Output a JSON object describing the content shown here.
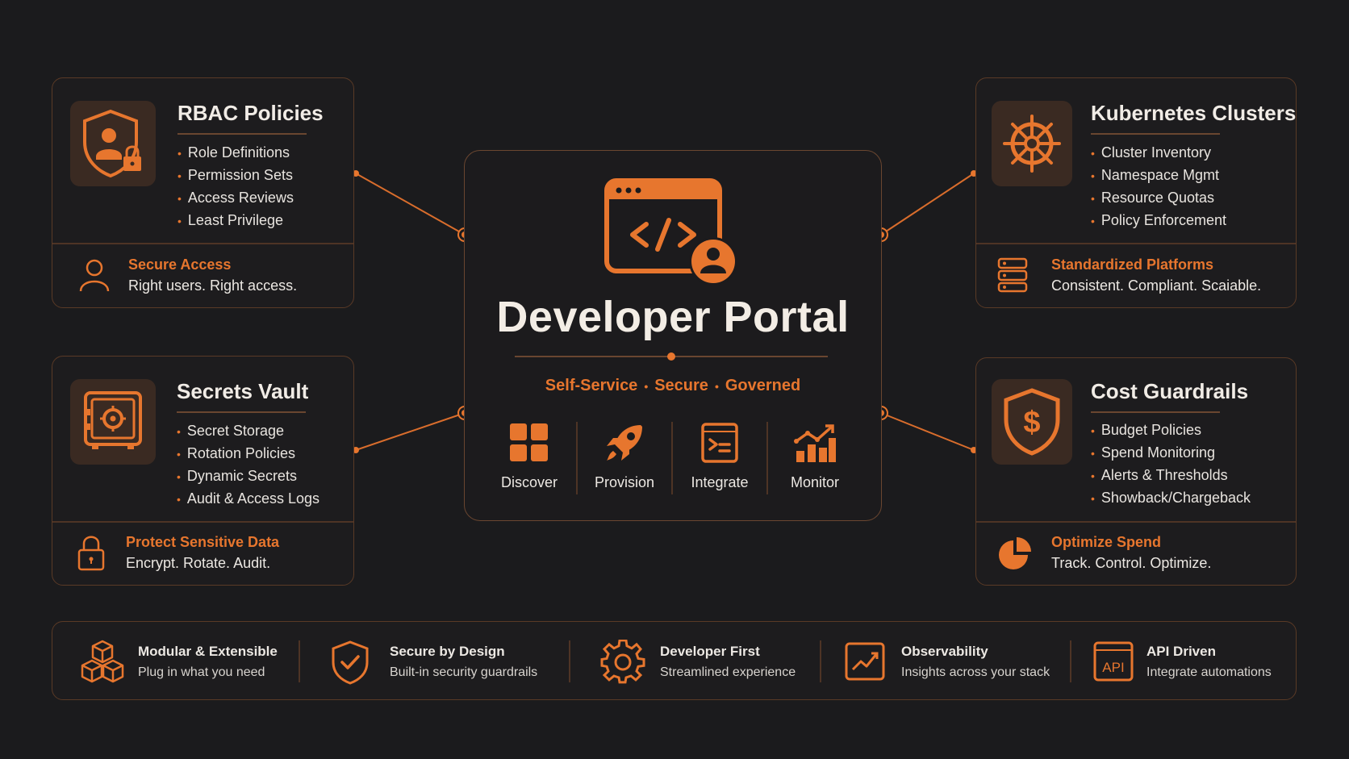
{
  "cards": {
    "rbac": {
      "title": "RBAC Policies",
      "items": [
        "Role Definitions",
        "Permission Sets",
        "Access Reviews",
        "Least Privilege"
      ],
      "footer_title": "Secure Access",
      "footer_sub": "Right users. Right access."
    },
    "k8s": {
      "title": "Kubernetes Clusters",
      "items": [
        "Cluster Inventory",
        "Namespace Mgmt",
        "Resource Quotas",
        "Policy Enforcement"
      ],
      "footer_title": "Standardized Platforms",
      "footer_sub": "Consistent. Compliant. Scaiable."
    },
    "vault": {
      "title": "Secrets Vault",
      "items": [
        "Secret Storage",
        "Rotation Policies",
        "Dynamic Secrets",
        "Audit & Access Logs"
      ],
      "footer_title": "Protect Sensitive Data",
      "footer_sub": "Encrypt. Rotate. Audit."
    },
    "cost": {
      "title": "Cost Guardrails",
      "items": [
        "Budget Policies",
        "Spend Monitoring",
        "Alerts & Thresholds",
        "Showback/Chargeback"
      ],
      "footer_title": "Optimize Spend",
      "footer_sub": "Track. Control. Optimize."
    }
  },
  "center": {
    "title": "Developer Portal",
    "tagline": [
      "Self-Service",
      "Secure",
      "Governed"
    ],
    "actions": [
      "Discover",
      "Provision",
      "Integrate",
      "Monitor"
    ]
  },
  "features": [
    {
      "title": "Modular & Extensible",
      "sub": "Plug in what you need",
      "icon": "cubes-icon"
    },
    {
      "title": "Secure by Design",
      "sub": "Built-in security guardrails",
      "icon": "shield-check-icon"
    },
    {
      "title": "Developer First",
      "sub": "Streamlined experience",
      "icon": "gear-icon"
    },
    {
      "title": "Observability",
      "sub": "Insights across your stack",
      "icon": "chart-icon"
    },
    {
      "title": "API Driven",
      "sub": "Integrate automations",
      "icon": "api-icon",
      "icon_text": "API"
    }
  ],
  "colors": {
    "accent": "#e7762e",
    "background": "#1b1b1d",
    "border": "#5a3a26"
  }
}
